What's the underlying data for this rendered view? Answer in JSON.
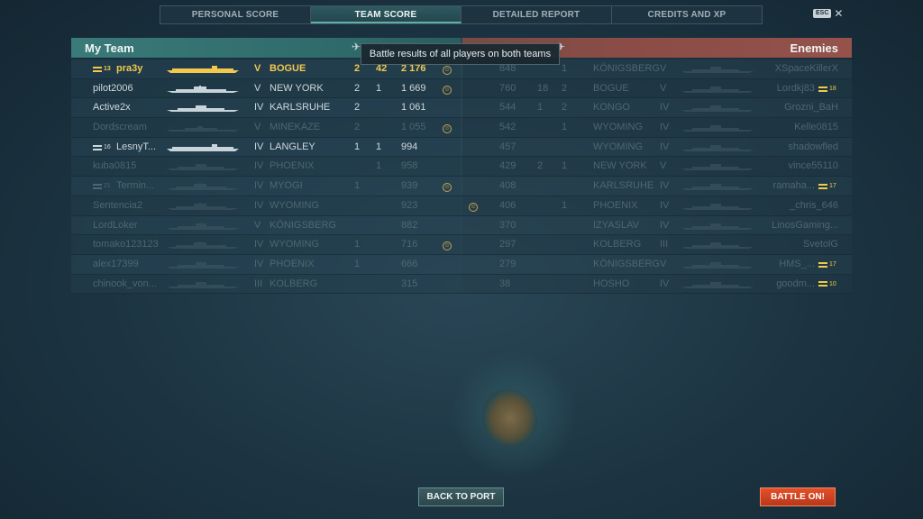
{
  "tabs": [
    {
      "label": "PERSONAL SCORE",
      "active": false
    },
    {
      "label": "TEAM SCORE",
      "active": true
    },
    {
      "label": "DETAILED REPORT",
      "active": false
    },
    {
      "label": "CREDITS AND XP",
      "active": false
    }
  ],
  "esc": {
    "key": "ESC",
    "close": "✕"
  },
  "my_team": {
    "title": "My Team"
  },
  "enemies": {
    "title": "Enemies"
  },
  "tooltip": "Battle results of all players on both teams",
  "colors": {
    "my_team": "#3a7a78",
    "enemies": "#8a4c46",
    "highlight": "#f2c94c",
    "battle_button": "#d9451f"
  },
  "my_rows": [
    {
      "rank": "13",
      "player": "pra3y",
      "tier": "V",
      "ship": "BOGUE",
      "c1": "2",
      "c2": "42",
      "score": "2 176",
      "medal": true,
      "me": true,
      "dead": false,
      "class": "cv"
    },
    {
      "rank": "",
      "player": "pilot2006",
      "tier": "V",
      "ship": "NEW YORK",
      "c1": "2",
      "c2": "1",
      "score": "1 669",
      "medal": true,
      "me": false,
      "dead": false,
      "class": "bb"
    },
    {
      "rank": "",
      "player": "Active2x",
      "tier": "IV",
      "ship": "KARLSRUHE",
      "c1": "2",
      "c2": "",
      "score": "1 061",
      "medal": false,
      "me": false,
      "dead": false,
      "class": "ca"
    },
    {
      "rank": "",
      "player": "Dordscream",
      "tier": "V",
      "ship": "MINEKAZE",
      "c1": "2",
      "c2": "",
      "score": "1 055",
      "medal": true,
      "me": false,
      "dead": true,
      "class": "dd"
    },
    {
      "rank": "16",
      "player": "LesnyT...",
      "tier": "IV",
      "ship": "LANGLEY",
      "c1": "1",
      "c2": "1",
      "score": "994",
      "medal": false,
      "me": false,
      "dead": false,
      "class": "cv"
    },
    {
      "rank": "",
      "player": "kuba0815",
      "tier": "IV",
      "ship": "PHOENIX",
      "c1": "",
      "c2": "1",
      "score": "958",
      "medal": false,
      "me": false,
      "dead": true,
      "class": "ca"
    },
    {
      "rank": "21",
      "player": "Termin...",
      "tier": "IV",
      "ship": "MYOGI",
      "c1": "1",
      "c2": "",
      "score": "939",
      "medal": true,
      "me": false,
      "dead": true,
      "class": "bb"
    },
    {
      "rank": "",
      "player": "Sentencia2",
      "tier": "IV",
      "ship": "WYOMING",
      "c1": "",
      "c2": "",
      "score": "923",
      "medal": false,
      "me": false,
      "dead": true,
      "class": "bb"
    },
    {
      "rank": "",
      "player": "LordLoker",
      "tier": "V",
      "ship": "KÖNIGSBERG",
      "c1": "",
      "c2": "",
      "score": "882",
      "medal": false,
      "me": false,
      "dead": true,
      "class": "ca"
    },
    {
      "rank": "",
      "player": "tomako123123",
      "tier": "IV",
      "ship": "WYOMING",
      "c1": "1",
      "c2": "",
      "score": "716",
      "medal": true,
      "me": false,
      "dead": true,
      "class": "bb"
    },
    {
      "rank": "",
      "player": "alex17399",
      "tier": "IV",
      "ship": "PHOENIX",
      "c1": "1",
      "c2": "",
      "score": "666",
      "medal": false,
      "me": false,
      "dead": true,
      "class": "ca"
    },
    {
      "rank": "",
      "player": "chinook_von...",
      "tier": "III",
      "ship": "KOLBERG",
      "c1": "",
      "c2": "",
      "score": "315",
      "medal": false,
      "me": false,
      "dead": true,
      "class": "ca"
    }
  ],
  "enemy_rows": [
    {
      "medal": false,
      "score": "848",
      "c2": "",
      "c1": "1",
      "ship": "KÖNIGSBERG",
      "tier": "V",
      "player": "XSpaceKillerX",
      "rank": "",
      "dead": true
    },
    {
      "medal": false,
      "score": "760",
      "c2": "18",
      "c1": "2",
      "ship": "BOGUE",
      "tier": "V",
      "player": "Lordkj83",
      "rank": "18",
      "dead": true
    },
    {
      "medal": false,
      "score": "544",
      "c2": "1",
      "c1": "2",
      "ship": "KONGO",
      "tier": "IV",
      "player": "Grozni_BaH",
      "rank": "",
      "dead": true
    },
    {
      "medal": false,
      "score": "542",
      "c2": "",
      "c1": "1",
      "ship": "WYOMING",
      "tier": "IV",
      "player": "Kelle0815",
      "rank": "",
      "dead": true
    },
    {
      "medal": false,
      "score": "457",
      "c2": "",
      "c1": "",
      "ship": "WYOMING",
      "tier": "IV",
      "player": "shadowfled",
      "rank": "",
      "dead": true
    },
    {
      "medal": false,
      "score": "429",
      "c2": "2",
      "c1": "1",
      "ship": "NEW YORK",
      "tier": "V",
      "player": "vince55110",
      "rank": "",
      "dead": true
    },
    {
      "medal": false,
      "score": "408",
      "c2": "",
      "c1": "",
      "ship": "KARLSRUHE",
      "tier": "IV",
      "player": "ramaha...",
      "rank": "17",
      "dead": true
    },
    {
      "medal": true,
      "score": "406",
      "c2": "",
      "c1": "1",
      "ship": "PHOENIX",
      "tier": "IV",
      "player": "_chris_646",
      "rank": "",
      "dead": true
    },
    {
      "medal": false,
      "score": "370",
      "c2": "",
      "c1": "",
      "ship": "IZYASLAV",
      "tier": "IV",
      "player": "LinosGaming...",
      "rank": "",
      "dead": true
    },
    {
      "medal": false,
      "score": "297",
      "c2": "",
      "c1": "",
      "ship": "KOLBERG",
      "tier": "III",
      "player": "SvetolG",
      "rank": "",
      "dead": true
    },
    {
      "medal": false,
      "score": "279",
      "c2": "",
      "c1": "",
      "ship": "KÖNIGSBERG",
      "tier": "V",
      "player": "HMS_...",
      "rank": "17",
      "dead": true
    },
    {
      "medal": false,
      "score": "38",
      "c2": "",
      "c1": "",
      "ship": "HOSHO",
      "tier": "IV",
      "player": "goodm...",
      "rank": "10",
      "dead": true
    }
  ],
  "buttons": {
    "back": "BACK TO PORT",
    "battle": "BATTLE ON!"
  }
}
